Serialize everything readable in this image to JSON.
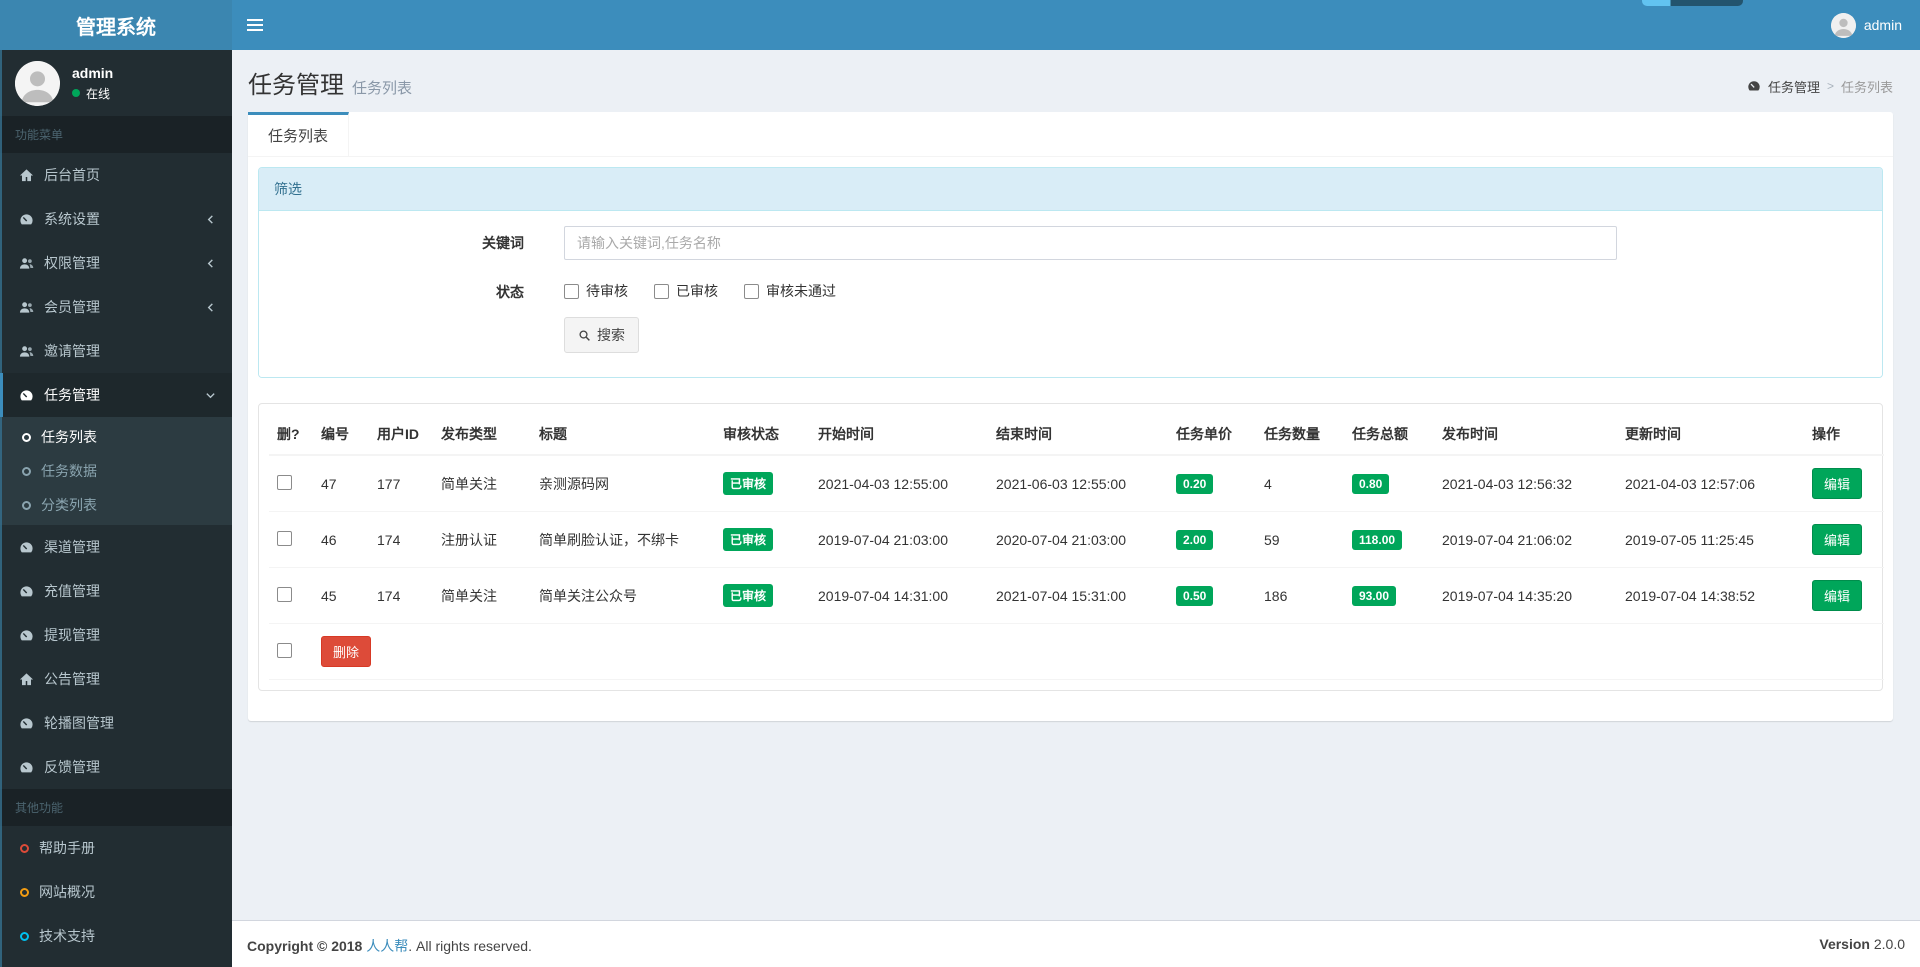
{
  "colors": {
    "accent": "#3c8dbc",
    "success": "#00a65a",
    "danger": "#dd4b39",
    "warning": "#f39c12",
    "aqua": "#00c0ef",
    "sidebar_bg": "#222d32",
    "panel_header_bg": "#d9edf7"
  },
  "app": {
    "title": "管理系统"
  },
  "header": {
    "user_name": "admin"
  },
  "sidebar": {
    "user": {
      "name": "admin",
      "status": "在线"
    },
    "section_main": "功能菜单",
    "section_other": "其他功能",
    "menu": [
      {
        "label": "后台首页",
        "icon": "home-icon"
      },
      {
        "label": "系统设置",
        "icon": "tachometer-icon"
      },
      {
        "label": "权限管理",
        "icon": "users-icon"
      },
      {
        "label": "会员管理",
        "icon": "users-icon"
      },
      {
        "label": "邀请管理",
        "icon": "users-icon"
      },
      {
        "label": "任务管理",
        "icon": "tachometer-icon"
      },
      {
        "label": "渠道管理",
        "icon": "tachometer-icon"
      },
      {
        "label": "充值管理",
        "icon": "tachometer-icon"
      },
      {
        "label": "提现管理",
        "icon": "tachometer-icon"
      },
      {
        "label": "公告管理",
        "icon": "home-icon"
      },
      {
        "label": "轮播图管理",
        "icon": "tachometer-icon"
      },
      {
        "label": "反馈管理",
        "icon": "tachometer-icon"
      }
    ],
    "task_submenu": [
      {
        "label": "任务列表"
      },
      {
        "label": "任务数据"
      },
      {
        "label": "分类列表"
      }
    ],
    "other": [
      {
        "label": "帮助手册",
        "icon": "circle-o-icon-red"
      },
      {
        "label": "网站概况",
        "icon": "circle-o-icon-yellow"
      },
      {
        "label": "技术支持",
        "icon": "circle-o-icon-aqua"
      }
    ]
  },
  "page": {
    "title": "任务管理",
    "subtitle": "任务列表",
    "breadcrumb": {
      "level1": "任务管理",
      "separator": ">",
      "level2": "任务列表"
    },
    "tab": "任务列表"
  },
  "filter": {
    "title": "筛选",
    "keyword_label": "关键词",
    "keyword_placeholder": "请输入关键词,任务名称",
    "keyword_value": "",
    "status_label": "状态",
    "status_options": [
      "待审核",
      "已审核",
      "审核未通过"
    ],
    "search_label": "搜索"
  },
  "table": {
    "columns": [
      "删?",
      "编号",
      "用户ID",
      "发布类型",
      "标题",
      "审核状态",
      "开始时间",
      "结束时间",
      "任务单价",
      "任务数量",
      "任务总额",
      "发布时间",
      "更新时间",
      "操作"
    ],
    "rows": [
      {
        "id": "47",
        "user_id": "177",
        "type": "简单关注",
        "title": "亲测源码网",
        "status": "已审核",
        "start": "2021-04-03 12:55:00",
        "end": "2021-06-03 12:55:00",
        "price": "0.20",
        "count": "4",
        "total": "0.80",
        "publish": "2021-04-03 12:56:32",
        "update": "2021-04-03 12:57:06"
      },
      {
        "id": "46",
        "user_id": "174",
        "type": "注册认证",
        "title": "简单刷脸认证，不绑卡",
        "status": "已审核",
        "start": "2019-07-04 21:03:00",
        "end": "2020-07-04 21:03:00",
        "price": "2.00",
        "count": "59",
        "total": "118.00",
        "publish": "2019-07-04 21:06:02",
        "update": "2019-07-05 11:25:45"
      },
      {
        "id": "45",
        "user_id": "174",
        "type": "简单关注",
        "title": "简单关注公众号",
        "status": "已审核",
        "start": "2019-07-04 14:31:00",
        "end": "2021-07-04 15:31:00",
        "price": "0.50",
        "count": "186",
        "total": "93.00",
        "publish": "2019-07-04 14:35:20",
        "update": "2019-07-04 14:38:52"
      }
    ],
    "actions": {
      "edit": "编辑",
      "delete": "删除"
    }
  },
  "footer": {
    "copyright_prefix": "Copyright © 2018",
    "brand": "人人帮",
    "copyright_suffix": ". All rights reserved.",
    "version_label": "Version",
    "version_value": "2.0.0"
  }
}
